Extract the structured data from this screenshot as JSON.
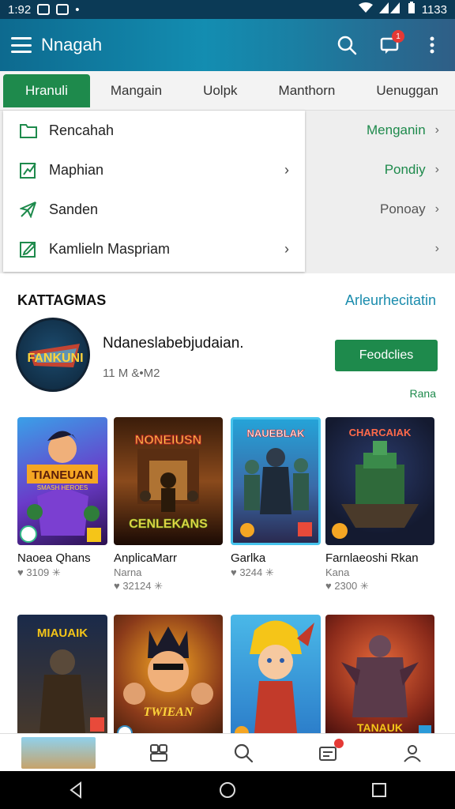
{
  "status_bar": {
    "time": "1:92",
    "battery": "1133"
  },
  "app_bar": {
    "title": "Nnagah",
    "notification_badge": "1"
  },
  "tabs": [
    {
      "label": "Hranuli",
      "active": true
    },
    {
      "label": "Mangain",
      "active": false
    },
    {
      "label": "Uolpk",
      "active": false
    },
    {
      "label": "Manthorn",
      "active": false
    },
    {
      "label": "Uenuggan",
      "active": false
    }
  ],
  "menu": [
    {
      "label": "Rencahah",
      "icon": "folder-icon"
    },
    {
      "label": "Maphian",
      "icon": "chart-icon"
    },
    {
      "label": "Sanden",
      "icon": "send-icon"
    },
    {
      "label": "Kamlieln Maspriam",
      "icon": "edit-icon"
    }
  ],
  "side_items": [
    {
      "label": "Menganin",
      "color": "#1e8a4c"
    },
    {
      "label": "Pondiy",
      "color": "#1e8a4c"
    },
    {
      "label": "Ponoay",
      "color": "#555555"
    },
    {
      "label": "",
      "color": "#555555"
    }
  ],
  "section": {
    "title": "KATTAGMAS",
    "link": "Arleurhecitatin",
    "featured": {
      "art_text": "FANKUNI",
      "title": "Ndaneslabebjudaian.",
      "subtitle": "11 M &•M2",
      "button": "Feodclies",
      "link": "Rana"
    }
  },
  "games": [
    {
      "name": "Naoea Qhans",
      "meta": "♥ 3109 ✳",
      "art_text": "TIANEUAN",
      "art_sub": "SMASH HEROES"
    },
    {
      "name": "AnplicaMarr",
      "meta": "Narna",
      "meta2": "♥ 32124 ✳",
      "art_text": "NONEIUSN",
      "art_sub": "CENLEKANS"
    },
    {
      "name": "Garlka",
      "meta": "♥ 3244 ✳",
      "art_text": "NAUEBLAK",
      "art_sub": ""
    },
    {
      "name": "Farnlaeoshi Rkan",
      "meta": "Kana",
      "meta2": "♥ 2300 ✳",
      "art_text": "CHARCAIAK",
      "art_sub": ""
    },
    {
      "name": "",
      "meta": "",
      "art_text": "MIAUAIK",
      "art_sub": ""
    },
    {
      "name": "",
      "meta": "",
      "art_text": "",
      "art_sub": "TWIEAN"
    },
    {
      "name": "",
      "meta": "",
      "art_text": "",
      "art_sub": ""
    },
    {
      "name": "",
      "meta": "",
      "art_text": "",
      "art_sub": "TANAUK"
    }
  ],
  "colors": {
    "accent_green": "#1e8a4c",
    "link_blue": "#1a8cad",
    "app_bar": "#138db1"
  }
}
